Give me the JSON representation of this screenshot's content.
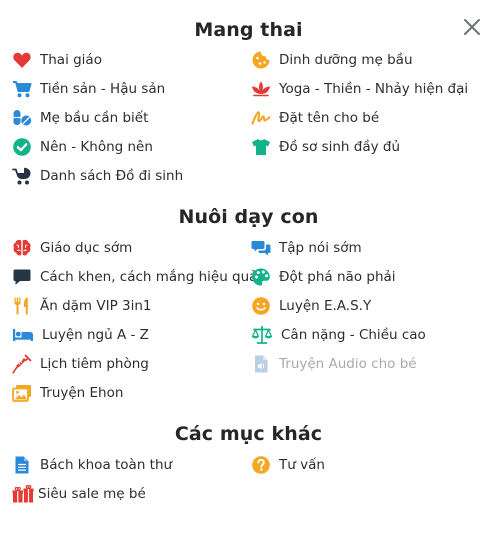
{
  "sections": [
    {
      "title": "Mang thai",
      "items": [
        {
          "label": "Thai giáo",
          "icon": "heart-icon"
        },
        {
          "label": "Dinh dưỡng mẹ bầu",
          "icon": "cookie-icon"
        },
        {
          "label": "Tiền sản - Hậu sản",
          "icon": "stroller-icon"
        },
        {
          "label": "Yoga - Thiền - Nhảy hiện đại",
          "icon": "lotus-icon"
        },
        {
          "label": "Mẹ bầu cần biết",
          "icon": "pills-icon"
        },
        {
          "label": "Đặt tên cho bé",
          "icon": "signature-icon"
        },
        {
          "label": "Nên - Không nên",
          "icon": "check-circle-icon"
        },
        {
          "label": "Đồ sơ sinh đầy đủ",
          "icon": "tshirt-icon"
        },
        {
          "label": "Danh sách Đồ đi sinh",
          "icon": "baby-carriage-icon"
        }
      ]
    },
    {
      "title": "Nuôi dạy con",
      "items": [
        {
          "label": "Giáo dục sớm",
          "icon": "brain-icon"
        },
        {
          "label": "Tập nói sớm",
          "icon": "chat-bubbles-icon"
        },
        {
          "label": "Cách khen, cách mắng hiệu quả",
          "icon": "speech-bubble-icon"
        },
        {
          "label": "Đột phá não phải",
          "icon": "palette-icon"
        },
        {
          "label": "Ăn dặm VIP 3in1",
          "icon": "utensils-icon"
        },
        {
          "label": "Luyện E.A.S.Y",
          "icon": "smile-icon"
        },
        {
          "label": "Luyện ngủ A - Z",
          "icon": "bed-icon"
        },
        {
          "label": "Cân nặng - Chiều cao",
          "icon": "scale-icon"
        },
        {
          "label": "Lịch tiêm phòng",
          "icon": "syringe-icon"
        },
        {
          "label": "Truyện Audio cho bé",
          "icon": "audio-file-icon",
          "disabled": true
        },
        {
          "label": "Truyện Ehon",
          "icon": "images-icon"
        }
      ]
    },
    {
      "title": "Các mục khác",
      "items": [
        {
          "label": "Bách khoa toàn thư",
          "icon": "document-icon"
        },
        {
          "label": "Tư vấn",
          "icon": "question-circle-icon"
        },
        {
          "label": "Siêu sale mẹ bé",
          "icon": "gifts-icon"
        }
      ]
    }
  ],
  "colors": {
    "red": "#e53935",
    "orange": "#f5a623",
    "blue": "#2b8ad8",
    "teal": "#12b38a",
    "dark_navy": "#263544",
    "disabled": "#a6abb0"
  }
}
